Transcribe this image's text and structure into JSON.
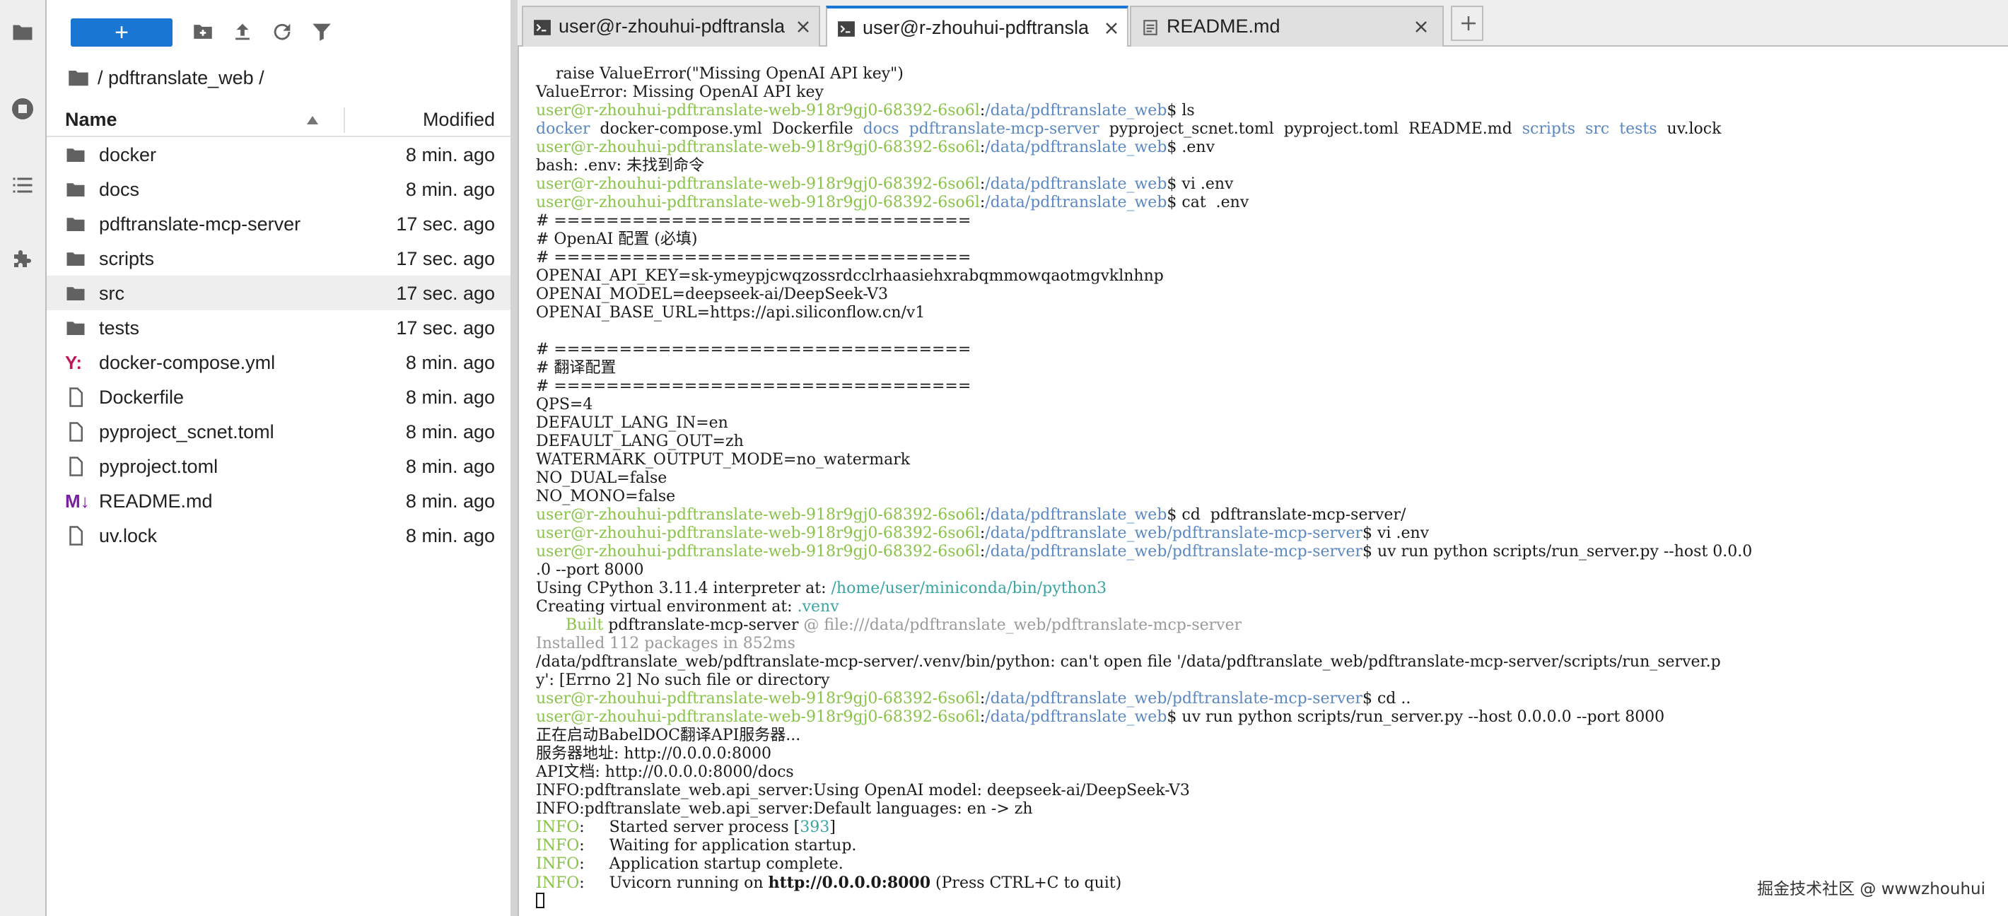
{
  "activity_bar": {
    "icons": [
      "folder-icon",
      "running-icon",
      "table-of-contents-icon",
      "extension-icon"
    ]
  },
  "file_browser": {
    "toolbar": {
      "new_launcher_label": "+",
      "icons": [
        "new-folder-icon",
        "upload-icon",
        "refresh-icon",
        "filter-icon"
      ]
    },
    "breadcrumb": "/ pdftranslate_web /",
    "columns": {
      "name": "Name",
      "modified": "Modified"
    },
    "files": [
      {
        "name": "docker",
        "modified": "8 min. ago",
        "type": "folder"
      },
      {
        "name": "docs",
        "modified": "8 min. ago",
        "type": "folder"
      },
      {
        "name": "pdftranslate-mcp-server",
        "modified": "17 sec. ago",
        "type": "folder"
      },
      {
        "name": "scripts",
        "modified": "17 sec. ago",
        "type": "folder"
      },
      {
        "name": "src",
        "modified": "17 sec. ago",
        "type": "folder",
        "selected": true
      },
      {
        "name": "tests",
        "modified": "17 sec. ago",
        "type": "folder"
      },
      {
        "name": "docker-compose.yml",
        "modified": "8 min. ago",
        "type": "yaml"
      },
      {
        "name": "Dockerfile",
        "modified": "8 min. ago",
        "type": "file"
      },
      {
        "name": "pyproject_scnet.toml",
        "modified": "8 min. ago",
        "type": "file"
      },
      {
        "name": "pyproject.toml",
        "modified": "8 min. ago",
        "type": "file"
      },
      {
        "name": "README.md",
        "modified": "8 min. ago",
        "type": "markdown"
      },
      {
        "name": "uv.lock",
        "modified": "8 min. ago",
        "type": "file"
      }
    ]
  },
  "tabs": [
    {
      "label": "user@r-zhouhui-pdftransla",
      "icon": "terminal-icon",
      "active": false
    },
    {
      "label": "user@r-zhouhui-pdftransla",
      "icon": "terminal-icon",
      "active": true
    },
    {
      "label": "README.md",
      "icon": "document-icon",
      "active": false
    }
  ],
  "add_tab_label": "+",
  "colors": {
    "accent": "#1976d2",
    "prompt_green": "#8ac349",
    "path_blue": "#5b88c2",
    "dir_blue": "#5b88c2",
    "venv_teal": "#3ba4a4",
    "muted_gray": "#9a9a9a",
    "yml_icon": "#c2185b",
    "md_icon": "#7b1fa2"
  },
  "terminal": {
    "lines": [
      [
        {
          "t": "    raise ValueError(\"Missing OpenAI API key\")"
        }
      ],
      [
        {
          "t": "ValueError: Missing OpenAI API key"
        }
      ],
      [
        {
          "t": "user@r-zhouhui-pdftranslate-web-918r9gj0-68392-6so6l",
          "c": "g"
        },
        {
          "t": ":"
        },
        {
          "t": "/data/pdftranslate_web",
          "c": "b"
        },
        {
          "t": "$ ls"
        }
      ],
      [
        {
          "t": "docker",
          "c": "b"
        },
        {
          "t": "  docker-compose.yml  Dockerfile  "
        },
        {
          "t": "docs",
          "c": "b"
        },
        {
          "t": "  "
        },
        {
          "t": "pdftranslate-mcp-server",
          "c": "b"
        },
        {
          "t": "  pyproject_scnet.toml  pyproject.toml  README.md  "
        },
        {
          "t": "scripts",
          "c": "b"
        },
        {
          "t": "  "
        },
        {
          "t": "src",
          "c": "b"
        },
        {
          "t": "  "
        },
        {
          "t": "tests",
          "c": "b"
        },
        {
          "t": "  uv.lock"
        }
      ],
      [
        {
          "t": "user@r-zhouhui-pdftranslate-web-918r9gj0-68392-6so6l",
          "c": "g"
        },
        {
          "t": ":"
        },
        {
          "t": "/data/pdftranslate_web",
          "c": "b"
        },
        {
          "t": "$ .env"
        }
      ],
      [
        {
          "t": "bash: .env: 未找到命令"
        }
      ],
      [
        {
          "t": "user@r-zhouhui-pdftranslate-web-918r9gj0-68392-6so6l",
          "c": "g"
        },
        {
          "t": ":"
        },
        {
          "t": "/data/pdftranslate_web",
          "c": "b"
        },
        {
          "t": "$ vi .env"
        }
      ],
      [
        {
          "t": "user@r-zhouhui-pdftranslate-web-918r9gj0-68392-6so6l",
          "c": "g"
        },
        {
          "t": ":"
        },
        {
          "t": "/data/pdftranslate_web",
          "c": "b"
        },
        {
          "t": "$ cat  .env"
        }
      ],
      [
        {
          "t": "# ================================"
        }
      ],
      [
        {
          "t": "# OpenAI 配置 (必填)"
        }
      ],
      [
        {
          "t": "# ================================"
        }
      ],
      [
        {
          "t": "OPENAI_API_KEY=sk-ymeypjcwqzossrdcclrhaasiehxrabqmmowqaotmgvklnhnp"
        }
      ],
      [
        {
          "t": "OPENAI_MODEL=deepseek-ai/DeepSeek-V3"
        }
      ],
      [
        {
          "t": "OPENAI_BASE_URL=https://api.siliconflow.cn/v1"
        }
      ],
      [
        {
          "t": ""
        }
      ],
      [
        {
          "t": "# ================================"
        }
      ],
      [
        {
          "t": "# 翻译配置"
        }
      ],
      [
        {
          "t": "# ================================"
        }
      ],
      [
        {
          "t": "QPS=4"
        }
      ],
      [
        {
          "t": "DEFAULT_LANG_IN=en"
        }
      ],
      [
        {
          "t": "DEFAULT_LANG_OUT=zh"
        }
      ],
      [
        {
          "t": "WATERMARK_OUTPUT_MODE=no_watermark"
        }
      ],
      [
        {
          "t": "NO_DUAL=false"
        }
      ],
      [
        {
          "t": "NO_MONO=false"
        }
      ],
      [
        {
          "t": "user@r-zhouhui-pdftranslate-web-918r9gj0-68392-6so6l",
          "c": "g"
        },
        {
          "t": ":"
        },
        {
          "t": "/data/pdftranslate_web",
          "c": "b"
        },
        {
          "t": "$ cd  pdftranslate-mcp-server/"
        }
      ],
      [
        {
          "t": "user@r-zhouhui-pdftranslate-web-918r9gj0-68392-6so6l",
          "c": "g"
        },
        {
          "t": ":"
        },
        {
          "t": "/data/pdftranslate_web/pdftranslate-mcp-server",
          "c": "b"
        },
        {
          "t": "$ vi .env"
        }
      ],
      [
        {
          "t": "user@r-zhouhui-pdftranslate-web-918r9gj0-68392-6so6l",
          "c": "g"
        },
        {
          "t": ":"
        },
        {
          "t": "/data/pdftranslate_web/pdftranslate-mcp-server",
          "c": "b"
        },
        {
          "t": "$ uv run python scripts/run_server.py --host 0.0.0"
        }
      ],
      [
        {
          "t": ".0 --port 8000"
        }
      ],
      [
        {
          "t": "Using CPython 3.11.4 interpreter at: "
        },
        {
          "t": "/home/user/miniconda/bin/python3",
          "c": "t"
        }
      ],
      [
        {
          "t": "Creating virtual environment at: "
        },
        {
          "t": ".venv",
          "c": "t"
        }
      ],
      [
        {
          "t": "      "
        },
        {
          "t": "Built",
          "c": "g"
        },
        {
          "t": " pdftranslate-mcp-server "
        },
        {
          "t": "@ file:///data/pdftranslate_web/pdftranslate-mcp-server",
          "c": "gr"
        }
      ],
      [
        {
          "t": "Installed 112 packages in 852ms",
          "c": "gr"
        }
      ],
      [
        {
          "t": "/data/pdftranslate_web/pdftranslate-mcp-server/.venv/bin/python: can't open file '/data/pdftranslate_web/pdftranslate-mcp-server/scripts/run_server.p"
        }
      ],
      [
        {
          "t": "y': [Errno 2] No such file or directory"
        }
      ],
      [
        {
          "t": "user@r-zhouhui-pdftranslate-web-918r9gj0-68392-6so6l",
          "c": "g"
        },
        {
          "t": ":"
        },
        {
          "t": "/data/pdftranslate_web/pdftranslate-mcp-server",
          "c": "b"
        },
        {
          "t": "$ cd .."
        }
      ],
      [
        {
          "t": "user@r-zhouhui-pdftranslate-web-918r9gj0-68392-6so6l",
          "c": "g"
        },
        {
          "t": ":"
        },
        {
          "t": "/data/pdftranslate_web",
          "c": "b"
        },
        {
          "t": "$ uv run python scripts/run_server.py --host 0.0.0.0 --port 8000"
        }
      ],
      [
        {
          "t": "正在启动BabelDOC翻译API服务器..."
        }
      ],
      [
        {
          "t": "服务器地址: http://0.0.0.0:8000"
        }
      ],
      [
        {
          "t": "API文档: http://0.0.0.0:8000/docs"
        }
      ],
      [
        {
          "t": "INFO:pdftranslate_web.api_server:Using OpenAI model: deepseek-ai/DeepSeek-V3"
        }
      ],
      [
        {
          "t": "INFO:pdftranslate_web.api_server:Default languages: en -> zh"
        }
      ],
      [
        {
          "t": "INFO",
          "c": "g"
        },
        {
          "t": ":     Started server process ["
        },
        {
          "t": "393",
          "c": "t"
        },
        {
          "t": "]"
        }
      ],
      [
        {
          "t": "INFO",
          "c": "g"
        },
        {
          "t": ":     Waiting for application startup."
        }
      ],
      [
        {
          "t": "INFO",
          "c": "g"
        },
        {
          "t": ":     Application startup complete."
        }
      ],
      [
        {
          "t": "INFO",
          "c": "g"
        },
        {
          "t": ":     Uvicorn running on "
        },
        {
          "t": "http://0.0.0.0:8000",
          "c": "bold"
        },
        {
          "t": " (Press CTRL+C to quit)"
        }
      ]
    ]
  },
  "watermark": "掘金技术社区 @ wwwzhouhui"
}
